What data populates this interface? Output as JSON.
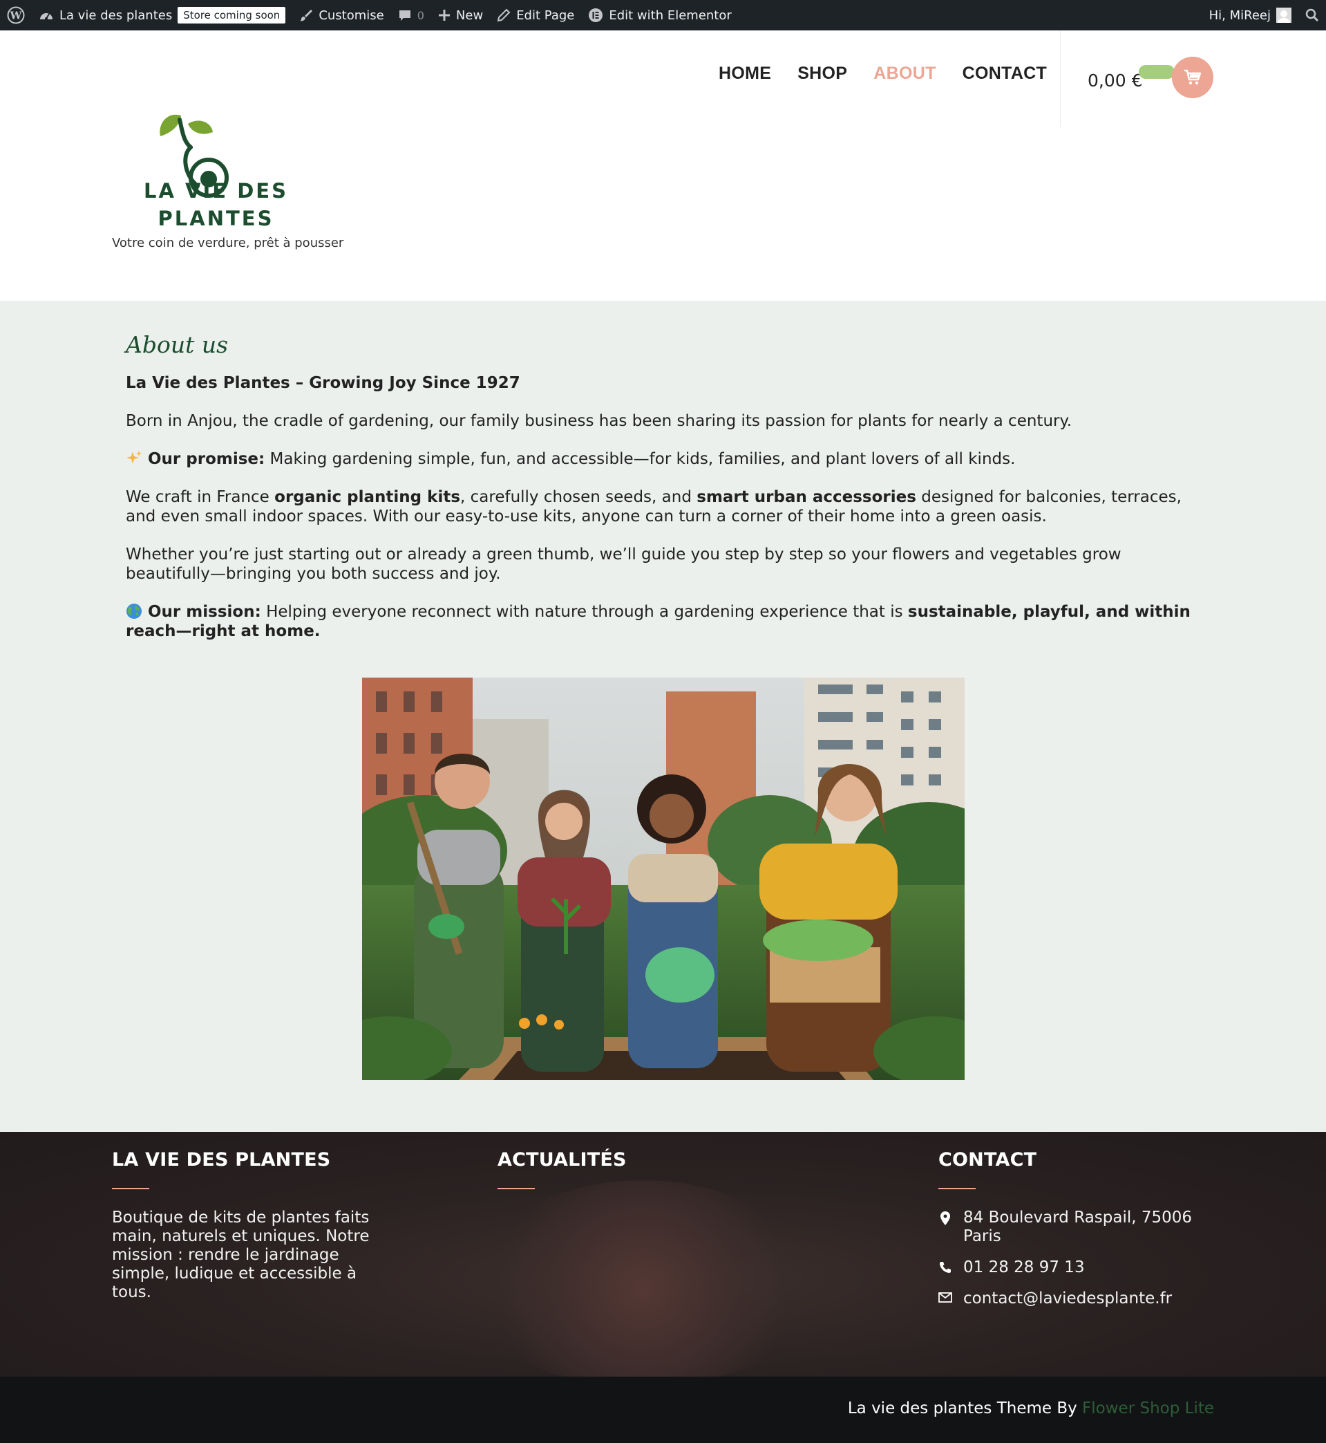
{
  "admin_bar": {
    "site_name": "La vie des plantes",
    "badge": "Store coming soon",
    "customise": "Customise",
    "comments_count": "0",
    "new": "New",
    "edit_page": "Edit Page",
    "edit_elementor": "Edit with Elementor",
    "greeting": "Hi, MiReej"
  },
  "header": {
    "logo_line1": "LA VIE DES",
    "logo_line2": "PLANTES",
    "tagline": "Votre coin de verdure, prêt à pousser",
    "nav": [
      "HOME",
      "SHOP",
      "ABOUT",
      "CONTACT"
    ],
    "active_nav": "ABOUT",
    "cart_total": "0,00 €"
  },
  "main": {
    "title": "About us",
    "heading": "La Vie des Plantes – Growing Joy Since 1927",
    "p1": "Born in Anjou, the cradle of gardening, our family business has been sharing its passion for plants for nearly a century.",
    "promise_label": "Our promise:",
    "promise_text": " Making gardening simple, fun, and accessible—for kids, families, and plant lovers of all kinds.",
    "p3_a": "We craft in France ",
    "p3_b": "organic planting kits",
    "p3_c": ", carefully chosen seeds, and ",
    "p3_d": "smart urban accessories",
    "p3_e": " designed for balconies, terraces, and even small indoor spaces. With our easy-to-use kits, anyone can turn a corner of their home into a green oasis.",
    "p4": "Whether you’re just starting out or already a green thumb, we’ll guide you step by step so your flowers and vegetables grow beautifully—bringing you both success and joy.",
    "mission_label": "Our mission:",
    "mission_text": " Helping everyone reconnect with nature through a gardening experience that is ",
    "mission_bold": "sustainable, playful, and within reach—right at home."
  },
  "footer": {
    "col1_title": "LA VIE DES PLANTES",
    "col1_text": "Boutique de kits de plantes faits main, naturels et uniques. Notre mission : rendre le jardinage simple, ludique et accessible à tous.",
    "col2_title": "ACTUALITÉS",
    "col3_title": "CONTACT",
    "address": "84 Boulevard Raspail, 75006 Paris",
    "phone": "01 28 28 97 13",
    "email": "contact@laviedesplante.fr"
  },
  "bottom": {
    "credit": "La vie des plantes Theme By ",
    "theme_link": "Flower Shop Lite"
  },
  "colors": {
    "accent": "#eda594",
    "brand_green": "#1b4d2e",
    "cart_pill": "#a4cd7e",
    "main_bg": "#ecf0ed",
    "admin_bg": "#1d2327"
  }
}
